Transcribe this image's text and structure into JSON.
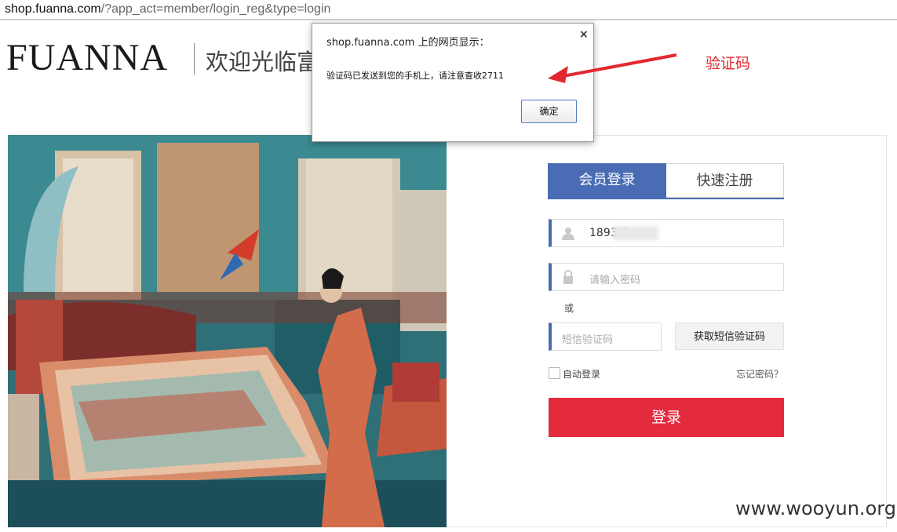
{
  "browser": {
    "url_domain": "shop.fuanna.com",
    "url_path": "/?app_act=member/login_reg&type=login"
  },
  "header": {
    "brand": "FUANNA",
    "welcome": "欢迎光临富安娜"
  },
  "login": {
    "tab_login": "会员登录",
    "tab_register": "快速注册",
    "phone_value": "1893   7",
    "password_placeholder": "请输入密码",
    "or_text": "或",
    "sms_placeholder": "短信验证码",
    "sms_button": "获取短信验证码",
    "remember_label": "自动登录",
    "forgot_link": "忘记密码？",
    "submit_label": "登录",
    "accent_color": "#4a6cb5",
    "submit_color": "#e32b3d"
  },
  "dialog": {
    "title": "shop.fuanna.com 上的网页显示：",
    "close": "×",
    "message": "验证码已发送到您的手机上，请注意查收2711",
    "ok_label": "确定"
  },
  "annotation": {
    "label": "验证码",
    "color": "#e2282e"
  },
  "watermark": "www.wooyun.org"
}
